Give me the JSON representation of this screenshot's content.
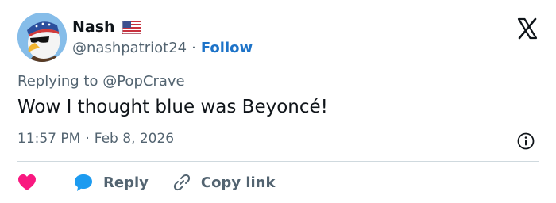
{
  "author": {
    "name": "Nash",
    "flag_icon": "us-flag-icon",
    "handle": "@nashpatriot24",
    "separator": "·",
    "follow_label": "Follow",
    "avatar_icon": "eagle-avatar-icon"
  },
  "brand_icon": "x-logo-icon",
  "tweet": {
    "replying_prefix": "Replying to",
    "replying_to": "@PopCrave",
    "text": "Wow I thought blue was Beyoncé!",
    "time": "11:57 PM",
    "meta_separator": "·",
    "date": "Feb 8, 2026"
  },
  "actions": {
    "like_icon": "heart-icon",
    "reply_icon": "chat-bubble-icon",
    "reply_label": "Reply",
    "copy_icon": "link-icon",
    "copy_label": "Copy link"
  },
  "colors": {
    "accent": "#1d73c8",
    "heart": "#f91880",
    "reply_bubble": "#1d9bf0",
    "secondary_text": "#536471",
    "primary_text": "#0f1419",
    "divider": "#cfd9de"
  }
}
